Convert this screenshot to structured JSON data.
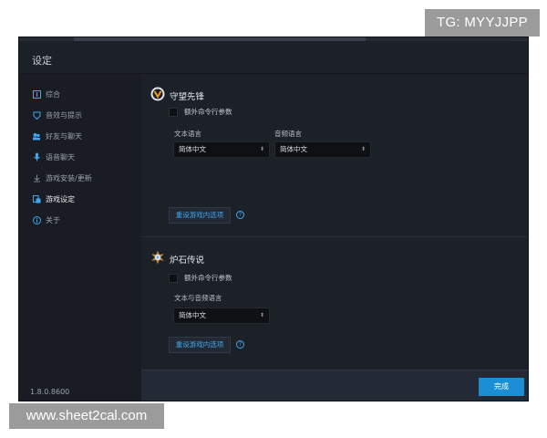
{
  "watermarks": {
    "tg": "TG: MYYJJPP",
    "site": "www.sheet2cal.com"
  },
  "window": {
    "title": "设定",
    "close_glyph": "×"
  },
  "sidebar": {
    "items": [
      {
        "label": "综合",
        "icon": "info-square-icon",
        "active": false
      },
      {
        "label": "音效与提示",
        "icon": "shield-icon",
        "active": false
      },
      {
        "label": "好友与聊天",
        "icon": "people-icon",
        "active": false
      },
      {
        "label": "语音聊天",
        "icon": "microphone-icon",
        "active": false
      },
      {
        "label": "游戏安装/更新",
        "icon": "download-icon",
        "active": false
      },
      {
        "label": "游戏设定",
        "icon": "game-settings-icon",
        "active": true
      },
      {
        "label": "关于",
        "icon": "info-circle-icon",
        "active": false
      }
    ],
    "version": "1.8.0.8600"
  },
  "games": {
    "overwatch": {
      "name": "守望先锋",
      "icon": "overwatch-logo-icon",
      "extra_args_label": "额外命令行参数",
      "extra_args_checked": false,
      "text_lang_label": "文本语言",
      "text_lang_value": "简体中文",
      "audio_lang_label": "音频语言",
      "audio_lang_value": "简体中文",
      "reset_label": "重设游戏内选项",
      "help_glyph": "?"
    },
    "hearthstone": {
      "name": "炉石传说",
      "icon": "hearthstone-logo-icon",
      "extra_args_label": "额外命令行参数",
      "extra_args_checked": false,
      "text_audio_lang_label": "文本与音频语言",
      "text_audio_lang_value": "简体中文",
      "reset_label": "重设游戏内选项",
      "help_glyph": "?"
    }
  },
  "footer": {
    "done_label": "完成"
  },
  "colors": {
    "accent": "#1a8fd6",
    "link": "#3fa9ef",
    "bg": "#1c2027"
  }
}
